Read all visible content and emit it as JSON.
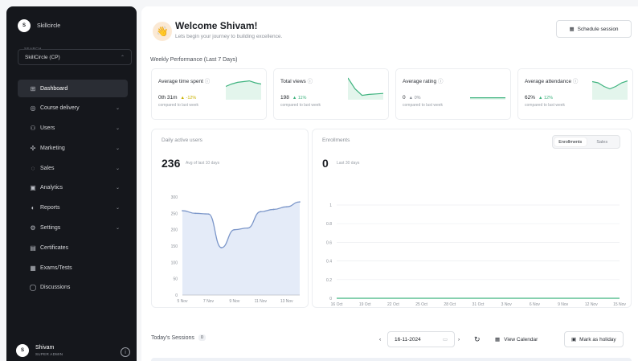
{
  "sidebar": {
    "brand": {
      "initial": "S",
      "name": "Skillcircle"
    },
    "switch_label": "SEARCH",
    "switch_value": "SkillCircle (CP)",
    "items": [
      {
        "label": "Dashboard",
        "icon": "dashboard-icon",
        "glyph": "⊞",
        "chevron": false,
        "active": true
      },
      {
        "label": "Course delivery",
        "icon": "course-icon",
        "glyph": "◎",
        "chevron": true
      },
      {
        "label": "Users",
        "icon": "users-icon",
        "glyph": "⚇",
        "chevron": true
      },
      {
        "label": "Marketing",
        "icon": "marketing-icon",
        "glyph": "✣",
        "chevron": true
      },
      {
        "label": "Sales",
        "icon": "sales-icon",
        "glyph": "◌",
        "chevron": true
      },
      {
        "label": "Analytics",
        "icon": "analytics-icon",
        "glyph": "▣",
        "chevron": true
      },
      {
        "label": "Reports",
        "icon": "reports-icon",
        "glyph": "◐",
        "chevron": true
      },
      {
        "label": "Settings",
        "icon": "settings-icon",
        "glyph": "⚙",
        "chevron": true
      },
      {
        "label": "Certificates",
        "icon": "certificate-icon",
        "glyph": "▤",
        "chevron": false
      },
      {
        "label": "Exams/Tests",
        "icon": "exams-icon",
        "glyph": "▦",
        "chevron": false
      },
      {
        "label": "Discussions",
        "icon": "discussions-icon",
        "glyph": "◯",
        "chevron": false
      }
    ],
    "user": {
      "initial": "S",
      "name": "Shivam",
      "role": "SUPER ADMIN"
    }
  },
  "header": {
    "emoji": "👋",
    "title": "Welcome Shivam!",
    "subtitle": "Lets begin your journey to building excellence.",
    "schedule_button": "Schedule session"
  },
  "weekly": {
    "heading": "Weekly Performance (Last 7 Days)",
    "kpis": [
      {
        "title": "Average time spent",
        "value": "0th 31m",
        "change": "-12%",
        "change_color": "#c9b200",
        "sub": "compared to last week",
        "spark": [
          0.45,
          0.35,
          0.28,
          0.25,
          0.22,
          0.3,
          0.35
        ],
        "color": "#3fb37f"
      },
      {
        "title": "Total views",
        "value": "198",
        "change": "11%",
        "change_color": "#3fb37f",
        "sub": "compared to last week",
        "spark": [
          0.1,
          0.55,
          0.82,
          0.78,
          0.76,
          0.74
        ],
        "color": "#3fb37f"
      },
      {
        "title": "Average rating",
        "value": "0",
        "change": "0%",
        "change_color": "#8b9098",
        "sub": "compared to last week",
        "spark": [
          0.92,
          0.92,
          0.92,
          0.92
        ],
        "color": "#3fb37f"
      },
      {
        "title": "Average attendance",
        "value": "62%",
        "change": "12%",
        "change_color": "#3fb37f",
        "sub": "compared to last week",
        "spark": [
          0.25,
          0.3,
          0.45,
          0.55,
          0.45,
          0.3,
          0.22
        ],
        "color": "#3fb37f"
      }
    ]
  },
  "daily": {
    "title": "Daily active users",
    "value": "236",
    "sub": "Avg of last 10 days"
  },
  "enrollments": {
    "title": "Enrollments",
    "value": "0",
    "sub": "Last 30 days",
    "tabs": [
      "Enrollments",
      "Sales"
    ]
  },
  "chart_data": [
    {
      "type": "area",
      "title": "Daily active users",
      "x": [
        "5 Nov",
        "6 Nov",
        "7 Nov",
        "8 Nov",
        "9 Nov",
        "10 Nov",
        "11 Nov",
        "12 Nov",
        "13 Nov",
        "14 Nov"
      ],
      "xticks": [
        "5 Nov",
        "7 Nov",
        "9 Nov",
        "11 Nov",
        "13 Nov"
      ],
      "values": [
        258,
        250,
        248,
        145,
        200,
        205,
        255,
        262,
        270,
        285
      ],
      "yticks": [
        0,
        50,
        100,
        150,
        200,
        250,
        300
      ],
      "ylim": [
        0,
        300
      ],
      "color": "#7b96c9",
      "fill": "#e4ebf8"
    },
    {
      "type": "line",
      "title": "Enrollments",
      "xticks": [
        "16 Oct",
        "19 Oct",
        "22 Oct",
        "25 Oct",
        "28 Oct",
        "31 Oct",
        "3 Nov",
        "6 Nov",
        "9 Nov",
        "12 Nov",
        "15 Nov"
      ],
      "values": [
        0,
        0,
        0,
        0,
        0,
        0,
        0,
        0,
        0,
        0,
        0
      ],
      "yticks": [
        0,
        0.2,
        0.4,
        0.6,
        0.8,
        1
      ],
      "ylim": [
        0,
        1
      ],
      "color": "#3fb37f"
    }
  ],
  "sessions": {
    "label": "Today's Sessions",
    "count": "0",
    "date": "16-11-2024",
    "view_calendar": "View Calendar",
    "mark_holiday": "Mark as holiday"
  }
}
